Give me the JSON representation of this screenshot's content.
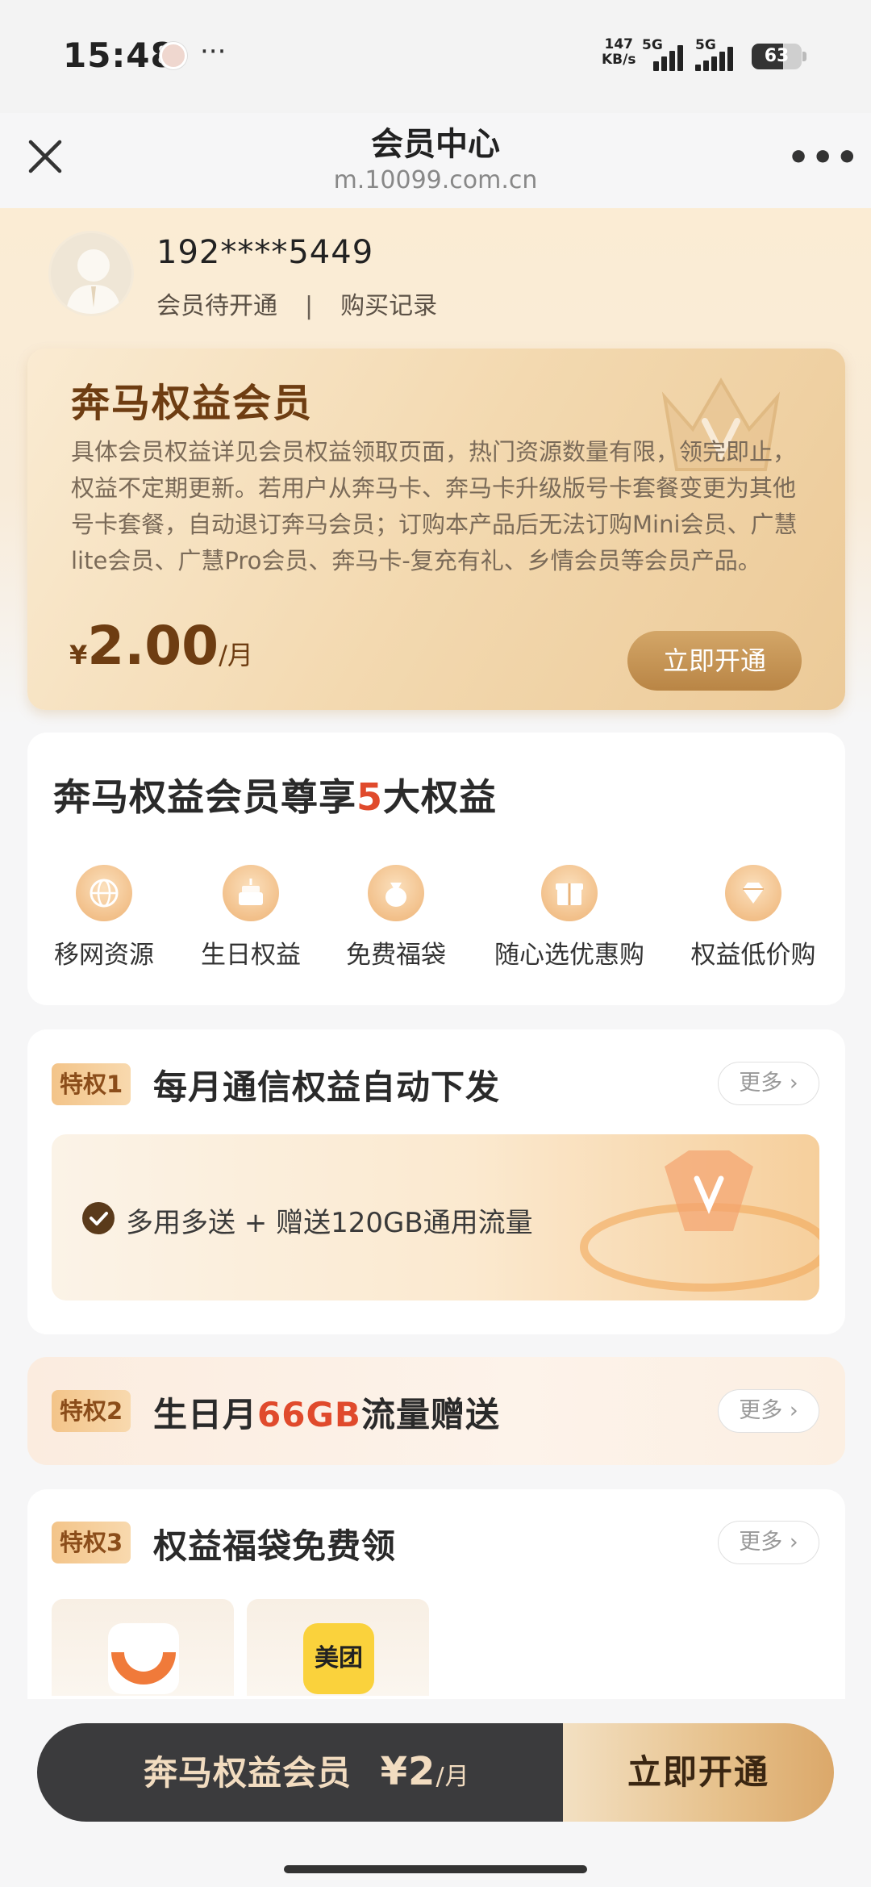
{
  "status_bar": {
    "time": "15:48",
    "more": "···",
    "net_speed_value": "147",
    "net_speed_unit": "KB/s",
    "sim1": "5G",
    "sim2": "5G",
    "battery": "63",
    "battery_level": 0.63
  },
  "nav": {
    "title": "会员中心",
    "url": "m.10099.com.cn",
    "more": "•••"
  },
  "user": {
    "phone": "192****5449",
    "status": "会员待开通",
    "separator": "|",
    "purchase_record": "购买记录"
  },
  "membership_card": {
    "title": "奔马权益会员",
    "description": "具体会员权益详见会员权益领取页面，热门资源数量有限，领完即止，权益不定期更新。若用户从奔马卡、奔马卡升级版号卡套餐变更为其他号卡套餐，自动退订奔马会员；订购本产品后无法订购Mini会员、广慧lite会员、广慧Pro会员、奔马卡-复充有礼、乡情会员等会员产品。",
    "price_symbol": "¥",
    "price": "2.00",
    "price_unit": "/月",
    "cta": "立即开通"
  },
  "benefits": {
    "title_prefix": "奔马权益会员尊享",
    "title_count": "5",
    "title_suffix": "大权益",
    "items": [
      {
        "label": "移网资源",
        "icon": "globe-icon"
      },
      {
        "label": "生日权益",
        "icon": "cake-icon"
      },
      {
        "label": "免费福袋",
        "icon": "lucky-bag-icon"
      },
      {
        "label": "随心选优惠购",
        "icon": "gift-box-icon"
      },
      {
        "label": "权益低价购",
        "icon": "diamond-icon"
      }
    ]
  },
  "privilege1": {
    "tag": "特权1",
    "title": "每月通信权益自动下发",
    "more": "更多 ›",
    "detail": "多用多送 + 赠送120GB通用流量"
  },
  "privilege2": {
    "tag": "特权2",
    "title_prefix": "生日月",
    "title_highlight": "66GB",
    "title_suffix": "流量赠送",
    "more": "更多 ›"
  },
  "privilege3": {
    "tag": "特权3",
    "title": "权益福袋免费领",
    "more": "更多 ›",
    "apps": [
      {
        "name": "didi-icon"
      },
      {
        "name": "美团"
      }
    ]
  },
  "bottom_bar": {
    "product": "奔马权益会员",
    "price": "¥2",
    "unit": "/月",
    "cta": "立即开通"
  },
  "colors": {
    "accent_gold": "#b98545",
    "accent_red": "#e04a2c",
    "dark_bar": "#3b3b3d"
  }
}
